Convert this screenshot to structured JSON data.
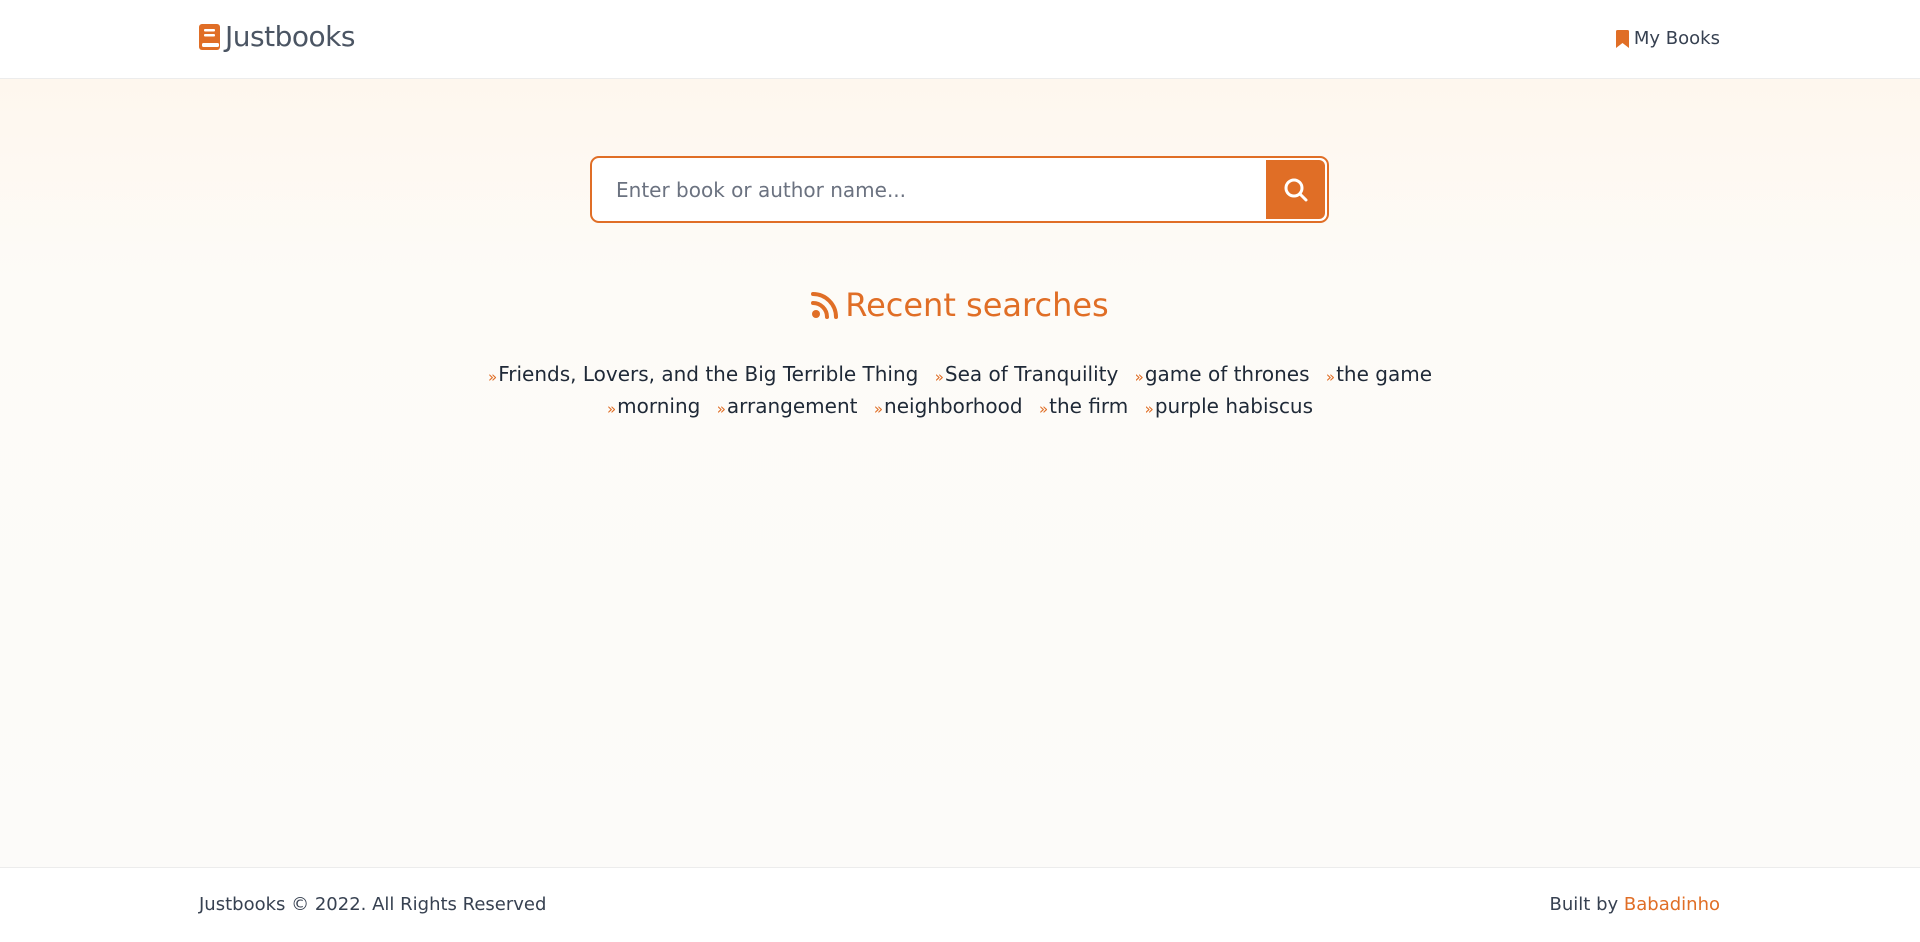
{
  "header": {
    "logo_text": "Justbooks",
    "logo_icon": "book-icon",
    "nav_my_books": "My Books",
    "nav_icon": "bookmark-icon"
  },
  "search": {
    "placeholder": "Enter book or author name...",
    "value": "",
    "button_icon": "search-icon"
  },
  "recent": {
    "title": "Recent searches",
    "icon": "rss-icon",
    "items": [
      "Friends, Lovers, and the Big Terrible Thing",
      "Sea of Tranquility",
      "game of thrones",
      "the game",
      "morning",
      "arrangement",
      "neighborhood",
      "the firm",
      "purple habiscus"
    ]
  },
  "footer": {
    "copyright": "Justbooks © 2022. All Rights Reserved",
    "built_by_label": "Built by",
    "author": "Babadinho"
  },
  "colors": {
    "accent": "#e06e26",
    "text": "#1f2937",
    "muted": "#4b5563",
    "background": "#fdfcfa"
  }
}
